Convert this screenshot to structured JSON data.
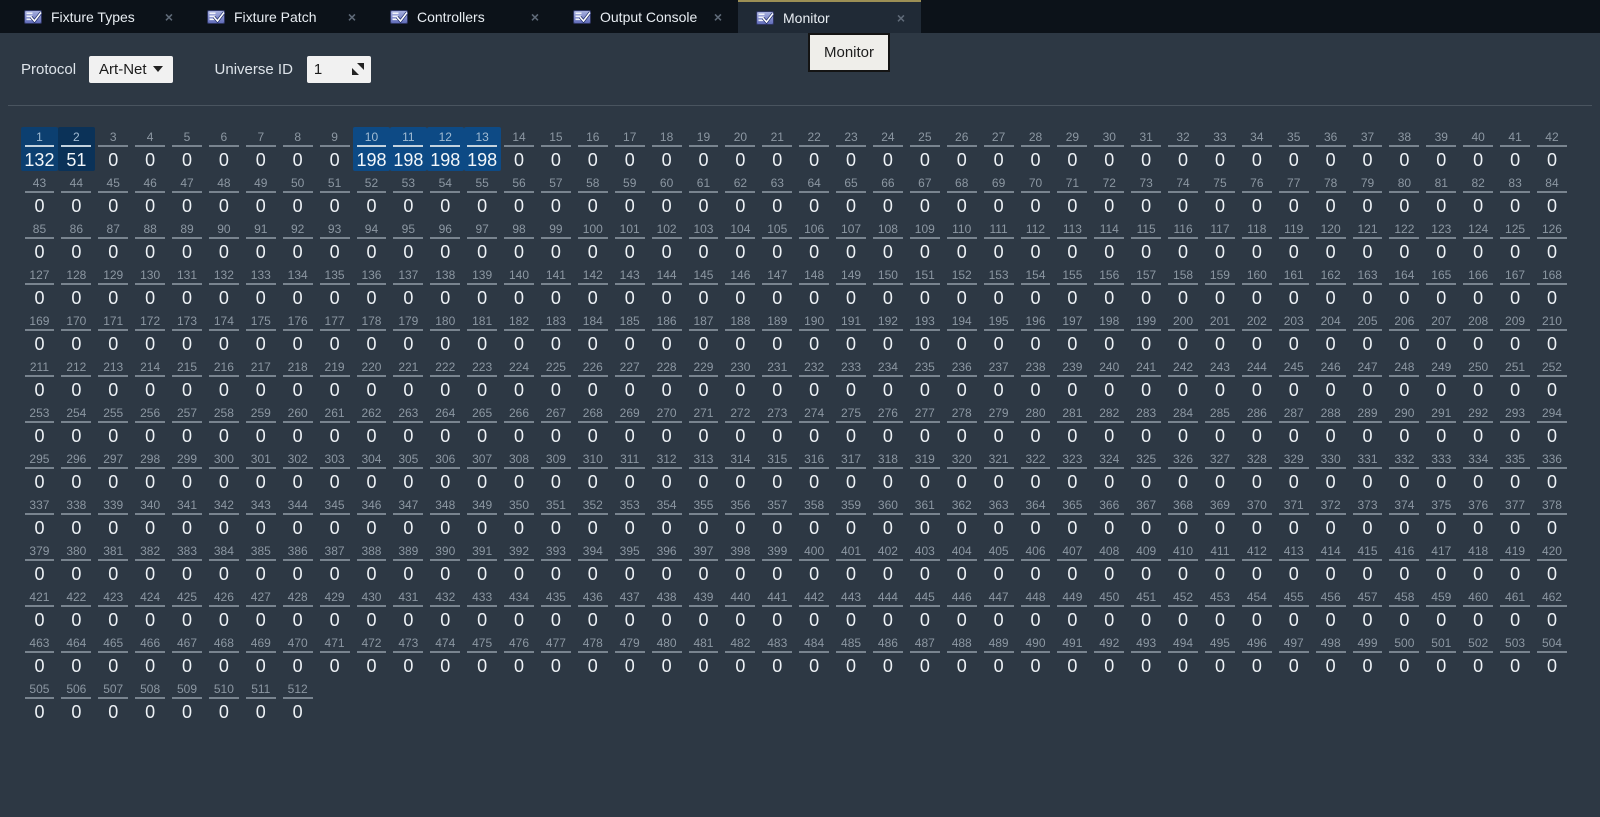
{
  "tabs": [
    {
      "label": "Fixture Types",
      "active": false
    },
    {
      "label": "Fixture Patch",
      "active": false
    },
    {
      "label": "Controllers",
      "active": false
    },
    {
      "label": "Output Console",
      "active": false
    },
    {
      "label": "Monitor",
      "active": true
    }
  ],
  "tab_close_glyph": "×",
  "tooltip": {
    "text": "Monitor"
  },
  "toolbar": {
    "protocol_label": "Protocol",
    "protocol_value": "Art-Net",
    "universe_label": "Universe ID",
    "universe_value": "1"
  },
  "grid": {
    "columns": 42,
    "channel_count": 512,
    "default_value": 0,
    "active_values": {
      "1": 132,
      "2": 51,
      "10": 198,
      "11": 198,
      "12": 198,
      "13": 198
    },
    "highlight_color_low": "#0a2a48",
    "highlight_color_high": "#0e5396"
  },
  "colors": {
    "background": "#2d3844",
    "tabbar_background": "#0c1219",
    "active_tab_background": "#202a36",
    "active_tab_accent": "#9c8f55",
    "channel_number": "#8c97a2",
    "channel_value": "#eef2f6",
    "separator": "#49545f"
  }
}
